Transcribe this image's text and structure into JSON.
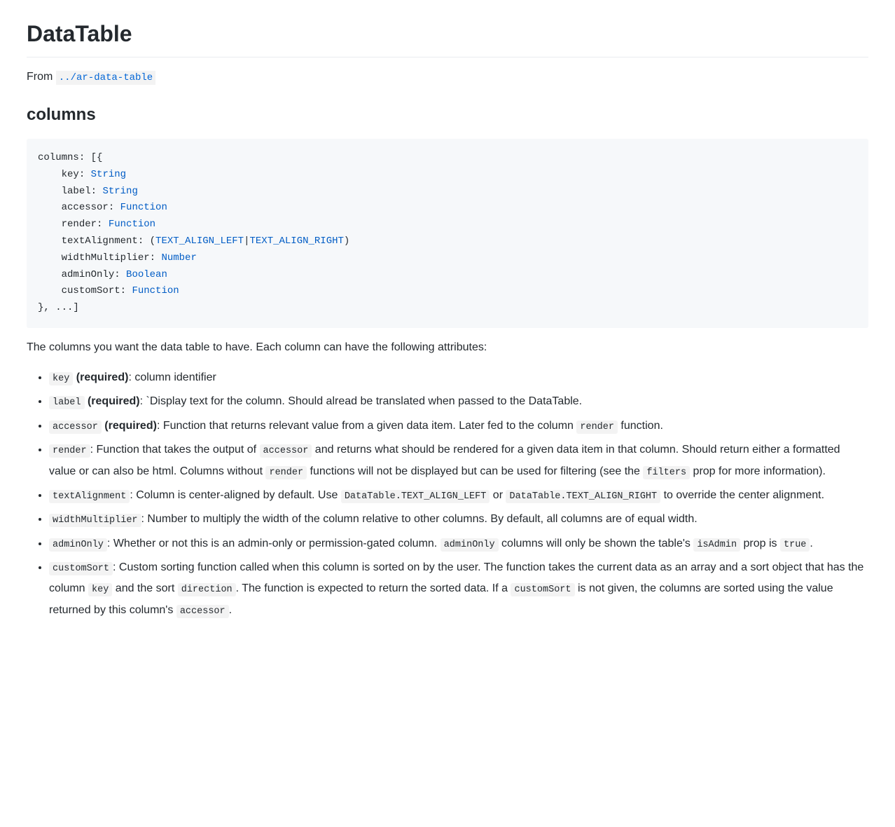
{
  "page": {
    "title": "DataTable",
    "from_label": "From",
    "from_link": "../ar-data-table",
    "section_columns": "columns",
    "columns_intro": "The columns you want the data table to have. Each column can have the following attributes:"
  },
  "code": {
    "l1a": "columns",
    "l1b": ": [{",
    "indent2": "    ",
    "key_k": "key",
    "label_k": "label",
    "accessor_k": "accessor",
    "render_k": "render",
    "textAlignment_k": "textAlignment",
    "widthMultiplier_k": "widthMultiplier",
    "adminOnly_k": "adminOnly",
    "customSort_k": "customSort",
    "colon_sp": ": ",
    "colon_paren": ": (",
    "String": "String",
    "Function": "Function",
    "Number": "Number",
    "Boolean": "Boolean",
    "TEXT_ALIGN_LEFT": "TEXT_ALIGN_LEFT",
    "pipe": "|",
    "TEXT_ALIGN_RIGHT": "TEXT_ALIGN_RIGHT",
    "rparen": ")",
    "end": "}, ...]"
  },
  "bullets": {
    "key_code": "key",
    "key_req": " (required)",
    "key_desc": ": column identifier",
    "label_code": "label",
    "label_req": " (required)",
    "label_desc": ": `Display text for the column. Should alread be translated when passed to the DataTable.",
    "accessor_code": "accessor",
    "accessor_req": " (required)",
    "accessor_desc_a": ": Function that returns relevant value from a given data item. Later fed to the column ",
    "accessor_inline_render": "render",
    "accessor_desc_b": " function.",
    "render_code": "render",
    "render_desc_a": ": Function that takes the output of ",
    "render_inline_accessor": "accessor",
    "render_desc_b": " and returns what should be rendered for a given data item in that column. Should return either a formatted value or can also be html. Columns without ",
    "render_inline_render": "render",
    "render_desc_c": " functions will not be displayed but can be used for filtering (see the ",
    "render_inline_filters": "filters",
    "render_desc_d": " prop for more information).",
    "ta_code": "textAlignment",
    "ta_desc_a": ": Column is center-aligned by default. Use ",
    "ta_inline_left": "DataTable.TEXT_ALIGN_LEFT",
    "ta_desc_b": " or ",
    "ta_inline_right": "DataTable.TEXT_ALIGN_RIGHT",
    "ta_desc_c": " to override the center alignment.",
    "wm_code": "widthMultiplier",
    "wm_desc": ": Number to multiply the width of the column relative to other columns. By default, all columns are of equal width.",
    "ao_code": "adminOnly",
    "ao_desc_a": ": Whether or not this is an admin-only or permission-gated column. ",
    "ao_inline_adminOnly": "adminOnly",
    "ao_desc_b": " columns will only be shown the table's ",
    "ao_inline_isAdmin": "isAdmin",
    "ao_desc_c": " prop is ",
    "ao_inline_true": "true",
    "ao_desc_d": ".",
    "cs_code": "customSort",
    "cs_desc_a": ": Custom sorting function called when this column is sorted on by the user. The function takes the current data as an array and a sort object that has the column ",
    "cs_inline_key": "key",
    "cs_desc_b": " and the sort ",
    "cs_inline_direction": "direction",
    "cs_desc_c": ". The function is expected to return the sorted data. If a ",
    "cs_inline_customSort": "customSort",
    "cs_desc_d": " is not given, the columns are sorted using the value returned by this column's ",
    "cs_inline_accessor": "accessor",
    "cs_desc_e": "."
  }
}
